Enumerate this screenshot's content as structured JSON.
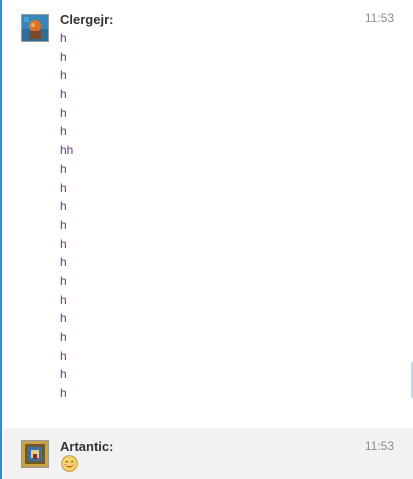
{
  "messages": [
    {
      "author": "Clergejr:",
      "time": "11:53",
      "lines": [
        "h",
        "h",
        "h",
        "h",
        "h",
        "h",
        "hh",
        "h",
        "h",
        "h",
        "h",
        "h",
        "h",
        "h",
        "h",
        "h",
        "h",
        "h",
        "h",
        "h"
      ]
    },
    {
      "author": "Artantic:",
      "time": "11:53",
      "emoji": "smiling-blush-emoji"
    }
  ],
  "colors": {
    "accent": "#2b8fd0",
    "message_text": "#6b3a8c",
    "author_text": "#333333",
    "time_text": "#8c8c8c",
    "second_message_bg": "#f2f2f2"
  }
}
